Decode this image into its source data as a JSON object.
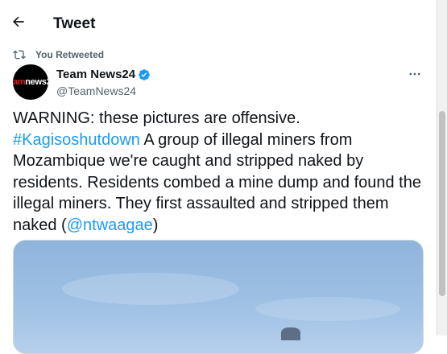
{
  "header": {
    "title": "Tweet",
    "back_icon": "arrow-left-icon"
  },
  "retweet": {
    "label": "You Retweeted",
    "icon": "retweet-icon"
  },
  "author": {
    "avatar_text_a": "team",
    "avatar_text_b": "news24",
    "name": "Team News24",
    "handle": "@TeamNews24",
    "verified_color": "#1d9bf0"
  },
  "tweet": {
    "part1": "WARNING: these pictures are offensive.",
    "hashtag": "#Kagisoshutdown",
    "part2": " A group of illegal miners from Mozambique we're caught and stripped naked by residents. Residents combed a mine dump and found the illegal miners. They first assaulted and stripped them naked (",
    "mention": "@ntwaagae",
    "part3": ")"
  },
  "colors": {
    "link": "#1d9bf0",
    "text": "#0f1419",
    "muted": "#536471"
  }
}
